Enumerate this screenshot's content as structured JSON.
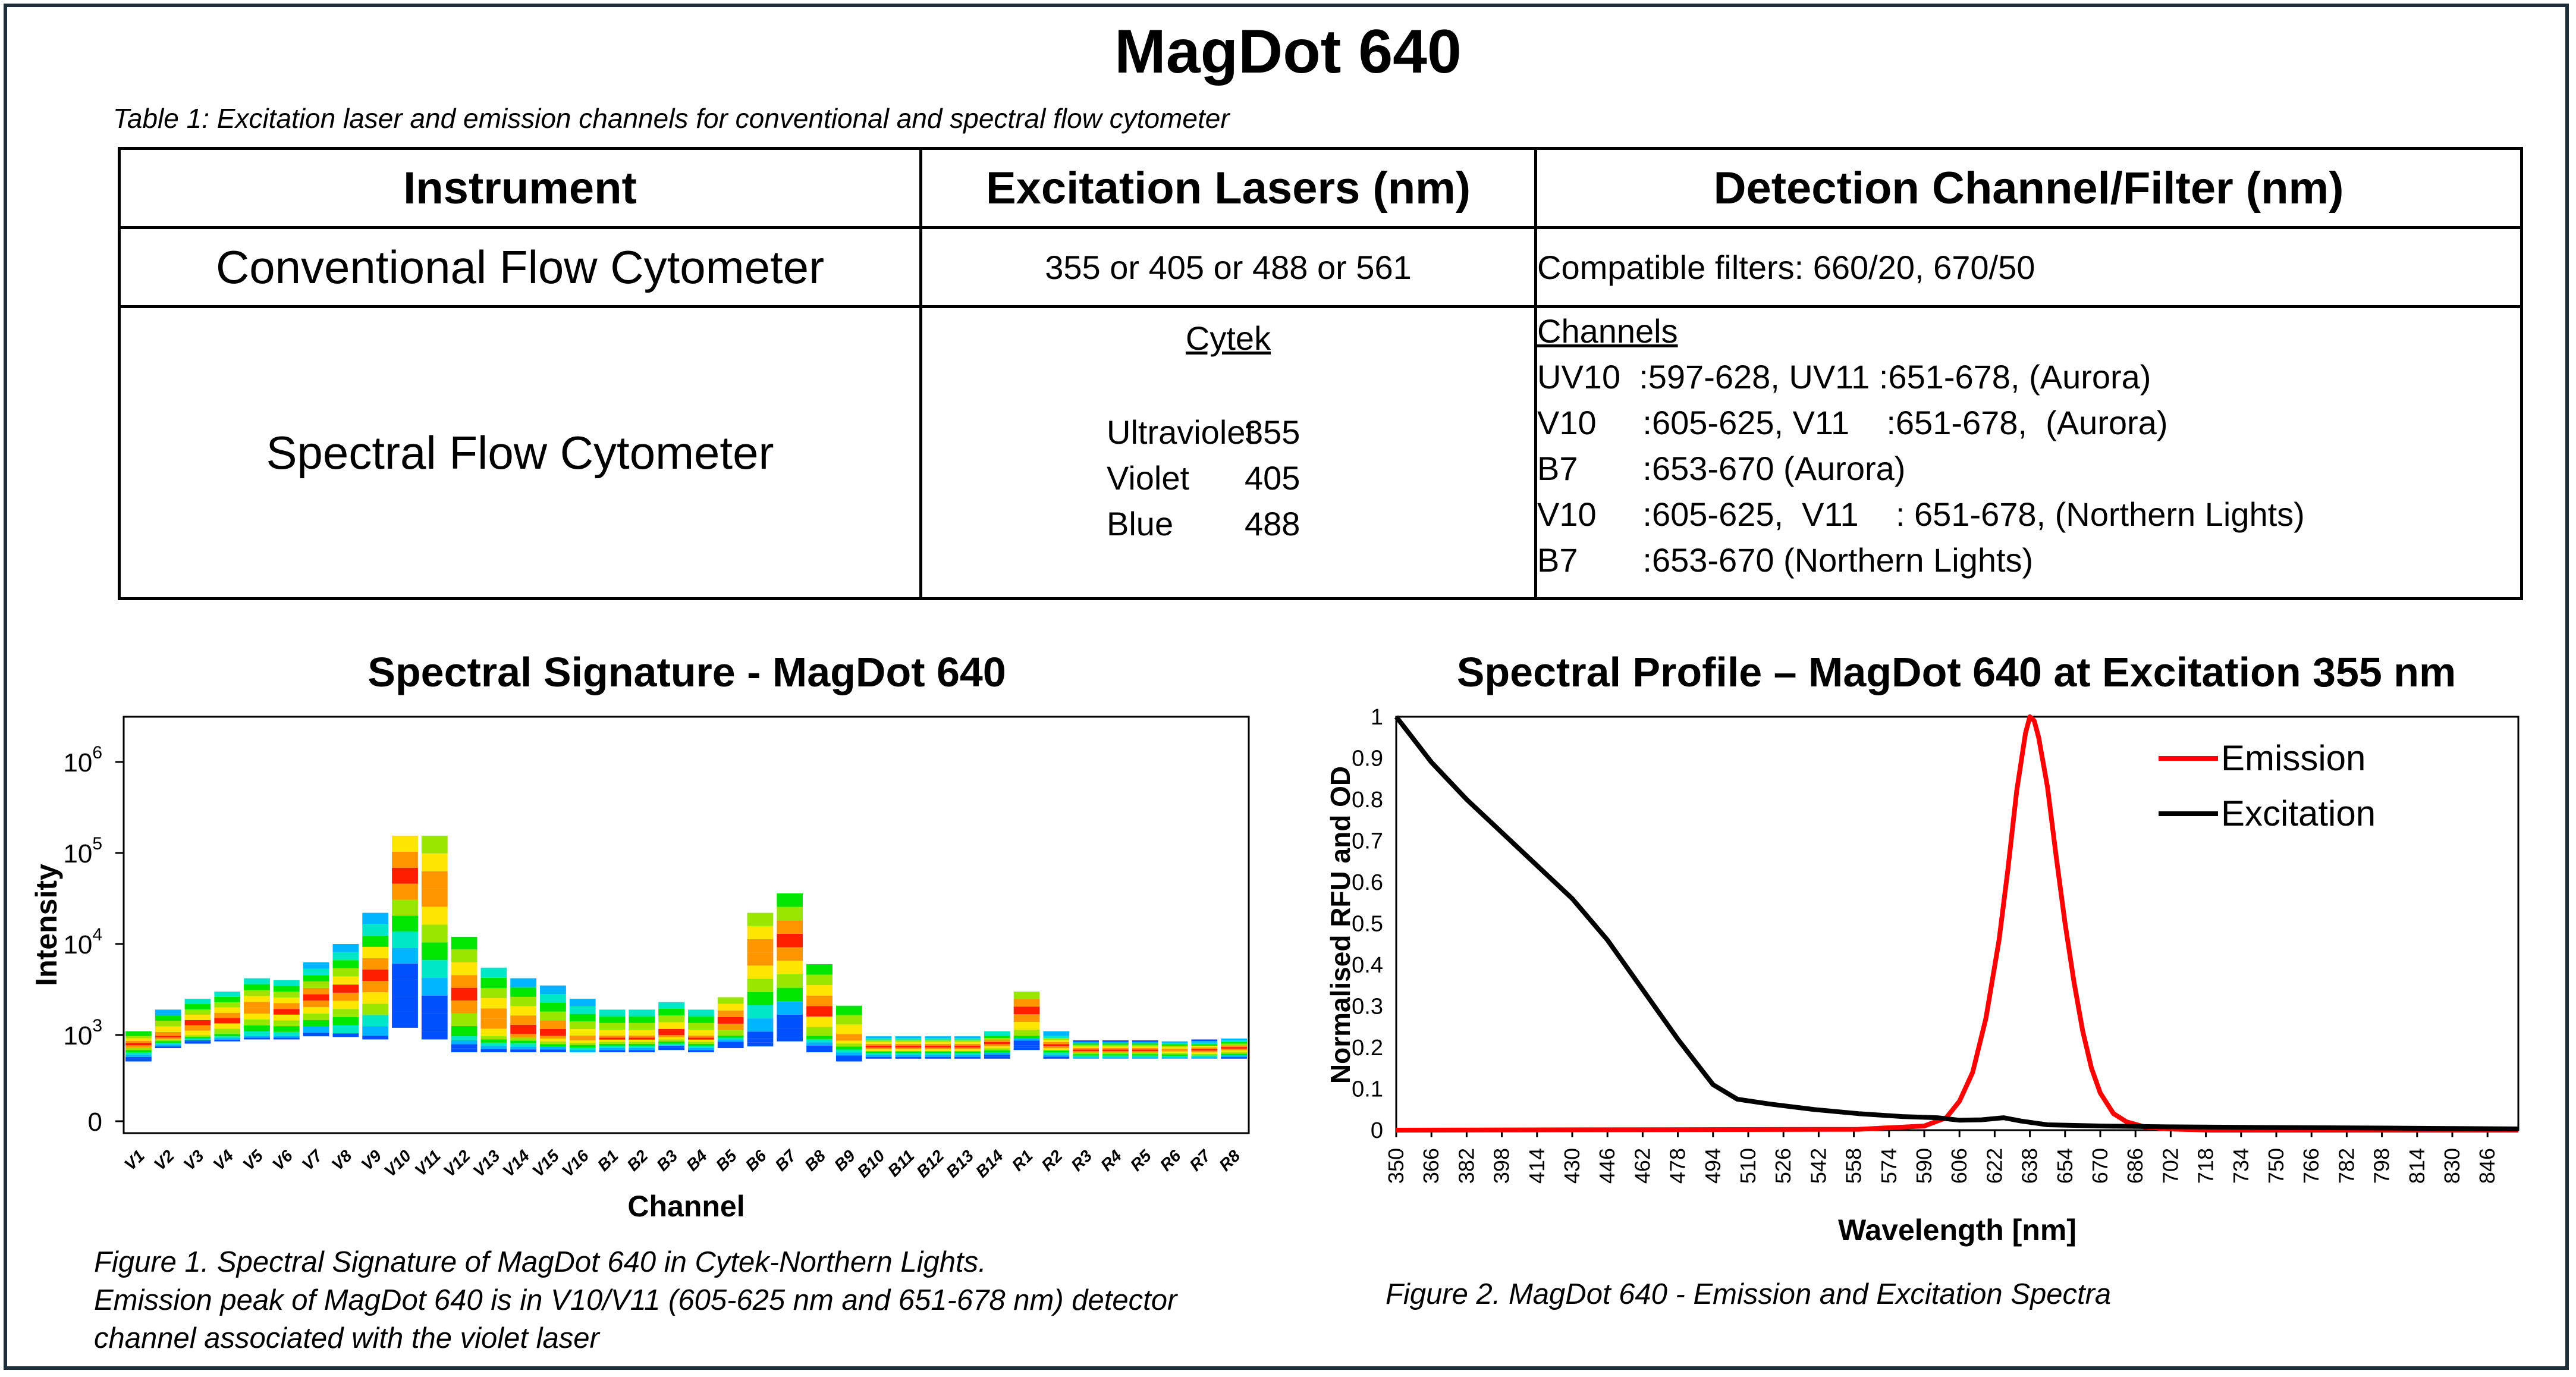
{
  "main_title": "MagDot 640",
  "table_caption": "Table 1: Excitation laser and emission channels for conventional and spectral flow cytometer",
  "table": {
    "headers": [
      "Instrument",
      "Excitation Lasers (nm)",
      "Detection Channel/Filter (nm)"
    ],
    "conventional": {
      "instrument": "Conventional Flow Cytometer",
      "lasers": "355 or 405 or 488 or 561",
      "detection": "Compatible filters: 660/20, 670/50"
    },
    "spectral": {
      "instrument": "Spectral Flow Cytometer",
      "lasers_heading": "Cytek",
      "lasers": [
        {
          "name": "Ultraviolet",
          "wavelength": "355"
        },
        {
          "name": "Violet",
          "wavelength": "405"
        },
        {
          "name": "Blue",
          "wavelength": "488"
        }
      ],
      "detection_heading": "Channels",
      "detection_lines": [
        "UV10  :597-628, UV11 :651-678, (Aurora)",
        "V10     :605-625, V11    :651-678,  (Aurora)",
        "B7       :653-670 (Aurora)",
        "V10     :605-625,  V11    : 651-678, (Northern Lights)",
        "B7       :653-670 (Northern Lights)"
      ]
    }
  },
  "figure1": {
    "title": "Spectral Signature - MagDot 640",
    "caption_lines": [
      "Figure 1. Spectral Signature of MagDot 640 in Cytek-Northern Lights.",
      "Emission peak of MagDot 640 is in V10/V11 (605-625 nm and 651-678 nm) detector",
      "channel associated with the violet laser"
    ]
  },
  "figure2": {
    "title": "Spectral Profile – MagDot 640 at Excitation 355 nm",
    "caption": "Figure 2. MagDot 640 - Emission and Excitation Spectra"
  },
  "chart_data": [
    {
      "type": "heatmap",
      "title": "Spectral Signature - MagDot 640",
      "xlabel": "Channel",
      "ylabel": "Intensity",
      "yscale": "log",
      "ytick_labels": [
        "0",
        "10^3",
        "10^4",
        "10^5",
        "10^6"
      ],
      "categories": [
        "V1",
        "V2",
        "V3",
        "V4",
        "V5",
        "V6",
        "V7",
        "V8",
        "V9",
        "V10",
        "V11",
        "V12",
        "V13",
        "V14",
        "V15",
        "V16",
        "B1",
        "B2",
        "B3",
        "B4",
        "B5",
        "B6",
        "B7",
        "B8",
        "B9",
        "B10",
        "B11",
        "B12",
        "B13",
        "B14",
        "R1",
        "R2",
        "R3",
        "R4",
        "R5",
        "R6",
        "R7",
        "R8"
      ],
      "low": [
        120,
        350,
        500,
        600,
        700,
        700,
        900,
        850,
        700,
        1200,
        700,
        250,
        250,
        250,
        250,
        250,
        250,
        250,
        300,
        250,
        350,
        400,
        600,
        250,
        120,
        150,
        150,
        150,
        150,
        150,
        300,
        150,
        150,
        150,
        150,
        150,
        150,
        150
      ],
      "median": [
        500,
        900,
        1300,
        1500,
        2000,
        1900,
        2500,
        3000,
        4500,
        60000,
        40000,
        3000,
        1500,
        1200,
        1000,
        800,
        800,
        800,
        1000,
        800,
        1500,
        8000,
        10000,
        2000,
        800,
        400,
        400,
        400,
        400,
        500,
        1800,
        450,
        300,
        300,
        300,
        300,
        300,
        350
      ],
      "high": [
        1100,
        1900,
        2500,
        3000,
        4200,
        4000,
        6300,
        10000,
        22000,
        155000,
        155000,
        12000,
        5500,
        4200,
        3500,
        2500,
        1900,
        1900,
        2300,
        1900,
        2600,
        22000,
        36000,
        6000,
        2100,
        900,
        900,
        900,
        900,
        1100,
        3000,
        1100,
        650,
        650,
        650,
        600,
        700,
        750
      ],
      "colormap": [
        "#0050ff",
        "#00b4ff",
        "#00e6c8",
        "#00e600",
        "#9be600",
        "#ffe600",
        "#ff9600",
        "#ff1e00"
      ]
    },
    {
      "type": "line",
      "title": "Spectral Profile – MagDot 640 at Excitation 355 nm",
      "xlabel": "Wavelength [nm]",
      "ylabel": "Normalised RFU and OD",
      "xlim": [
        350,
        860
      ],
      "ylim": [
        0,
        1
      ],
      "xticks": [
        350,
        366,
        382,
        398,
        414,
        430,
        446,
        462,
        478,
        494,
        510,
        526,
        542,
        558,
        574,
        590,
        606,
        622,
        638,
        654,
        670,
        686,
        702,
        718,
        734,
        750,
        766,
        782,
        798,
        814,
        830,
        846
      ],
      "yticks": [
        0,
        0.1,
        0.2,
        0.3,
        0.4,
        0.5,
        0.6,
        0.7,
        0.8,
        0.9,
        1
      ],
      "legend_position": "top-right",
      "series": [
        {
          "name": "Emission",
          "color": "#ff0000",
          "x": [
            350,
            560,
            590,
            600,
            606,
            612,
            618,
            624,
            628,
            632,
            636,
            638,
            640,
            642,
            646,
            650,
            654,
            658,
            662,
            666,
            670,
            676,
            682,
            690,
            700,
            720,
            860
          ],
          "y": [
            0,
            0.002,
            0.01,
            0.03,
            0.07,
            0.14,
            0.27,
            0.46,
            0.63,
            0.82,
            0.96,
            1,
            0.99,
            0.95,
            0.83,
            0.66,
            0.5,
            0.36,
            0.24,
            0.15,
            0.09,
            0.04,
            0.02,
            0.008,
            0.003,
            0,
            0
          ]
        },
        {
          "name": "Excitation",
          "color": "#000000",
          "x": [
            350,
            366,
            382,
            398,
            414,
            430,
            446,
            462,
            478,
            494,
            505,
            520,
            540,
            560,
            580,
            596,
            606,
            616,
            626,
            634,
            646,
            670,
            700,
            760,
            800,
            860
          ],
          "y": [
            1,
            0.89,
            0.8,
            0.72,
            0.64,
            0.56,
            0.46,
            0.34,
            0.22,
            0.11,
            0.075,
            0.063,
            0.05,
            0.04,
            0.033,
            0.03,
            0.024,
            0.025,
            0.03,
            0.022,
            0.013,
            0.01,
            0.008,
            0.006,
            0.005,
            0.003
          ]
        }
      ]
    }
  ]
}
